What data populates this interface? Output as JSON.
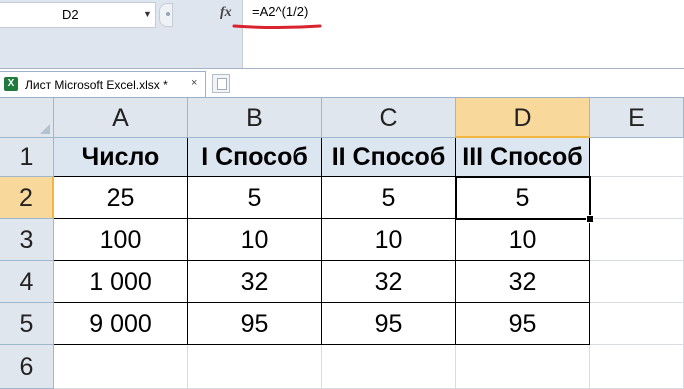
{
  "formula_bar": {
    "name_box": "D2",
    "fx_label": "fx",
    "formula": "=A2^(1/2)"
  },
  "tabs": {
    "active_label": "Лист Microsoft Excel.xlsx *",
    "close_label": "×"
  },
  "grid": {
    "columns": [
      "A",
      "B",
      "C",
      "D",
      "E"
    ],
    "rows": [
      "1",
      "2",
      "3",
      "4",
      "5",
      "6"
    ],
    "selected_column": "D",
    "selected_row": "2",
    "active_cell": "D2",
    "header_row": [
      "Число",
      "I Способ",
      "II Способ",
      "III Способ"
    ],
    "data_rows": [
      [
        "25",
        "5",
        "5",
        "5"
      ],
      [
        "100",
        "10",
        "10",
        "10"
      ],
      [
        "1 000",
        "32",
        "32",
        "32"
      ],
      [
        "9 000",
        "95",
        "95",
        "95"
      ]
    ]
  },
  "colors": {
    "header_fill": "#dce6f1",
    "selected_header": "#f9d99b",
    "annotation_underline": "#d9232e"
  }
}
